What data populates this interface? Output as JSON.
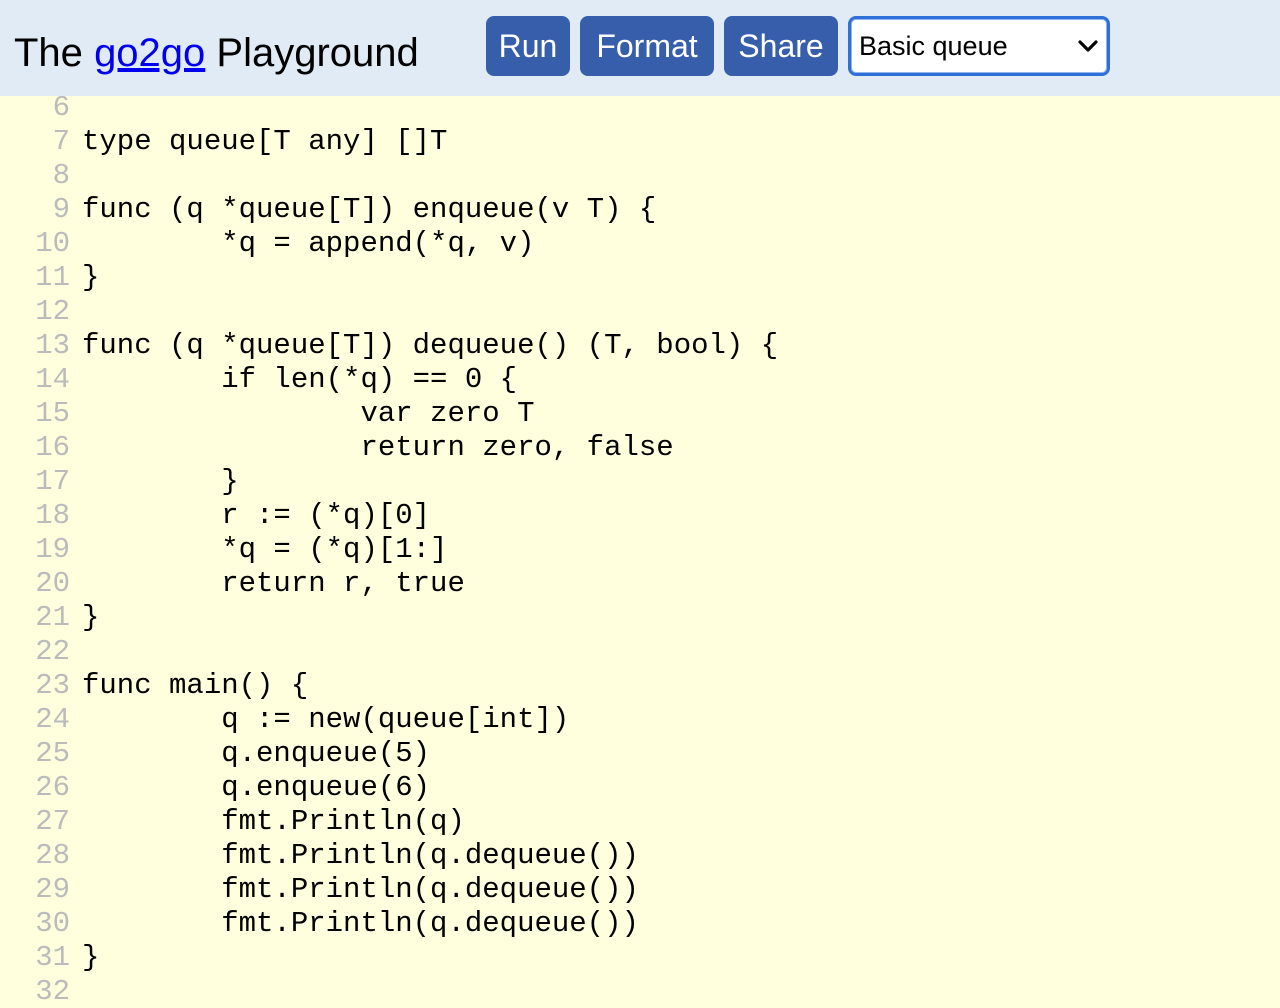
{
  "header": {
    "title_prefix": "The",
    "title_link": "go2go",
    "title_suffix": "Playground",
    "buttons": {
      "run": "Run",
      "format": "Format",
      "share": "Share"
    },
    "example_select": {
      "selected": "Basic queue"
    }
  },
  "editor": {
    "lines": [
      {
        "num": "6",
        "code": ""
      },
      {
        "num": "7",
        "code": "type queue[T any] []T"
      },
      {
        "num": "8",
        "code": ""
      },
      {
        "num": "9",
        "code": "func (q *queue[T]) enqueue(v T) {"
      },
      {
        "num": "10",
        "code": "        *q = append(*q, v)"
      },
      {
        "num": "11",
        "code": "}"
      },
      {
        "num": "12",
        "code": ""
      },
      {
        "num": "13",
        "code": "func (q *queue[T]) dequeue() (T, bool) {"
      },
      {
        "num": "14",
        "code": "        if len(*q) == 0 {"
      },
      {
        "num": "15",
        "code": "                var zero T"
      },
      {
        "num": "16",
        "code": "                return zero, false"
      },
      {
        "num": "17",
        "code": "        }"
      },
      {
        "num": "18",
        "code": "        r := (*q)[0]"
      },
      {
        "num": "19",
        "code": "        *q = (*q)[1:]"
      },
      {
        "num": "20",
        "code": "        return r, true"
      },
      {
        "num": "21",
        "code": "}"
      },
      {
        "num": "22",
        "code": ""
      },
      {
        "num": "23",
        "code": "func main() {"
      },
      {
        "num": "24",
        "code": "        q := new(queue[int])"
      },
      {
        "num": "25",
        "code": "        q.enqueue(5)"
      },
      {
        "num": "26",
        "code": "        q.enqueue(6)"
      },
      {
        "num": "27",
        "code": "        fmt.Println(q)"
      },
      {
        "num": "28",
        "code": "        fmt.Println(q.dequeue())"
      },
      {
        "num": "29",
        "code": "        fmt.Println(q.dequeue())"
      },
      {
        "num": "30",
        "code": "        fmt.Println(q.dequeue())"
      },
      {
        "num": "31",
        "code": "}"
      },
      {
        "num": "32",
        "code": ""
      }
    ]
  },
  "colors": {
    "header_bg": "#e0ebf5",
    "button_bg": "#375eab",
    "editor_bg": "#ffffdd",
    "line_number": "#bbbbbb",
    "link": "#0000ee"
  }
}
